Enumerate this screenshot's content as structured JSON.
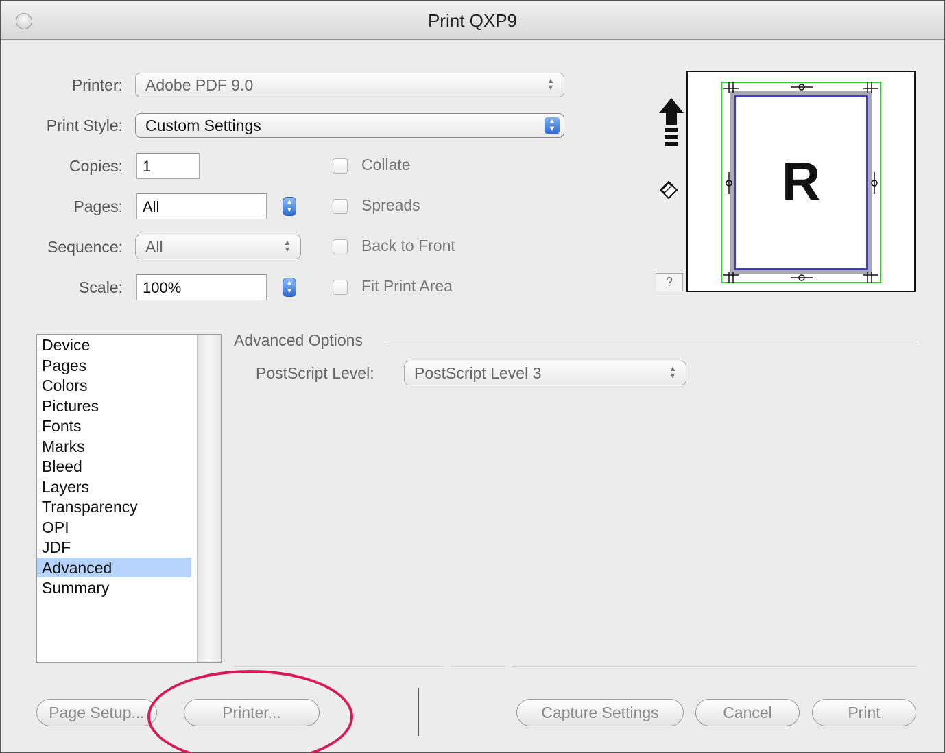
{
  "window": {
    "title": "Print QXP9"
  },
  "form": {
    "printer_label": "Printer:",
    "printer_value": "Adobe PDF 9.0",
    "print_style_label": "Print Style:",
    "print_style_value": "Custom Settings",
    "copies_label": "Copies:",
    "copies_value": "1",
    "pages_label": "Pages:",
    "pages_value": "All",
    "sequence_label": "Sequence:",
    "sequence_value": "All",
    "scale_label": "Scale:",
    "scale_value": "100%"
  },
  "checkboxes": {
    "collate": "Collate",
    "spreads": "Spreads",
    "back_to_front": "Back to Front",
    "fit_print_area": "Fit Print Area"
  },
  "preview": {
    "page_letter": "R",
    "help_label": "?"
  },
  "sidebar": {
    "items": [
      "Device",
      "Pages",
      "Colors",
      "Pictures",
      "Fonts",
      "Marks",
      "Bleed",
      "Layers",
      "Transparency",
      "OPI",
      "JDF",
      "Advanced",
      "Summary"
    ],
    "selected": "Advanced"
  },
  "advanced": {
    "group_title": "Advanced Options",
    "postscript_label": "PostScript Level:",
    "postscript_value": "PostScript Level 3"
  },
  "buttons": {
    "page_setup": "Page Setup...",
    "printer": "Printer...",
    "capture_settings": "Capture Settings",
    "cancel": "Cancel",
    "print": "Print"
  },
  "colors": {
    "highlight_circle": "#d8195b",
    "selection": "#b5d3fb",
    "accent_blue": "#2f6ad3"
  }
}
